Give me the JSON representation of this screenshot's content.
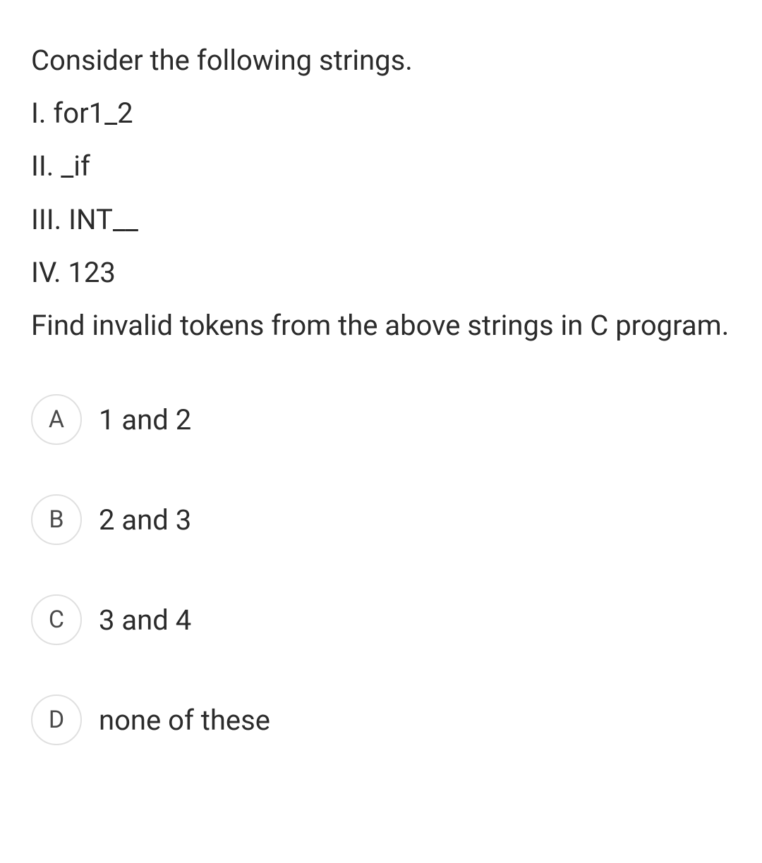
{
  "question": {
    "intro": "Consider the following strings.",
    "items": [
      "I. for1_2",
      "II. _if",
      "III. INT__",
      "IV. 123"
    ],
    "prompt": "Find invalid tokens from the above strings in C program."
  },
  "options": [
    {
      "letter": "A",
      "text": "1 and 2"
    },
    {
      "letter": "B",
      "text": "2 and 3"
    },
    {
      "letter": "C",
      "text": "3 and 4"
    },
    {
      "letter": "D",
      "text": "none of these"
    }
  ]
}
